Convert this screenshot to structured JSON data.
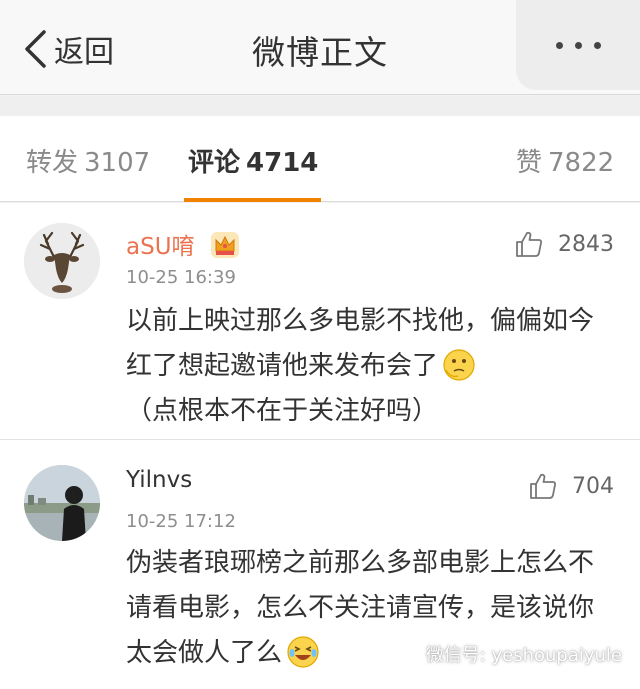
{
  "nav": {
    "back_label": "返回",
    "title": "微博正文"
  },
  "tabs": [
    {
      "label": "转发",
      "count": "3107"
    },
    {
      "label": "评论",
      "count": "4714"
    },
    {
      "label": "赞",
      "count": "7822"
    }
  ],
  "comments": [
    {
      "username": "aSU唷",
      "time": "10-25 16:39",
      "likes": "2843",
      "text": "以前上映过那么多电影不找他，偏偏如今红了想起邀请他来发布会了",
      "text_after_emoji": "（点根本不在于关注好吗）"
    },
    {
      "username": "Yilnvs",
      "time": "10-25 17:12",
      "likes": "704",
      "text": "伪装者琅琊榜之前那么多部电影上怎么不请看电影，怎么不关注请宣传，是该说你太会做人了么"
    }
  ],
  "watermark": "微信号: yeshoupaiyule",
  "colors": {
    "accent": "#f08200",
    "username_orange": "#eb7350"
  }
}
